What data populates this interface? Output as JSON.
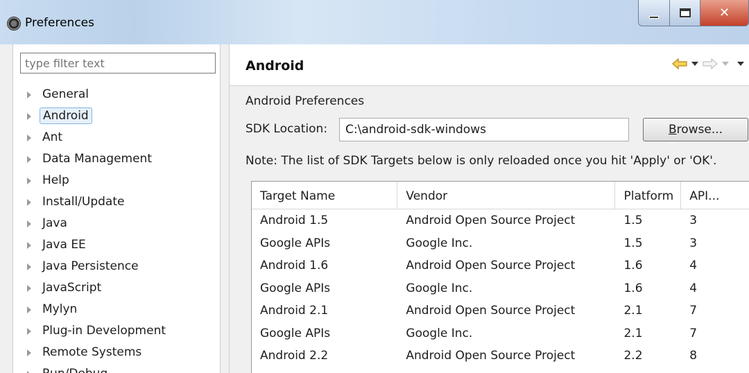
{
  "window": {
    "title": "Preferences"
  },
  "left": {
    "filter_placeholder": "type filter text",
    "tree": [
      {
        "label": "General",
        "selected": false
      },
      {
        "label": "Android",
        "selected": true
      },
      {
        "label": "Ant",
        "selected": false
      },
      {
        "label": "Data Management",
        "selected": false
      },
      {
        "label": "Help",
        "selected": false
      },
      {
        "label": "Install/Update",
        "selected": false
      },
      {
        "label": "Java",
        "selected": false
      },
      {
        "label": "Java EE",
        "selected": false
      },
      {
        "label": "Java Persistence",
        "selected": false
      },
      {
        "label": "JavaScript",
        "selected": false
      },
      {
        "label": "Mylyn",
        "selected": false
      },
      {
        "label": "Plug-in Development",
        "selected": false
      },
      {
        "label": "Remote Systems",
        "selected": false
      },
      {
        "label": "Run/Debug",
        "selected": false
      }
    ]
  },
  "main": {
    "heading": "Android",
    "prefs_label": "Android Preferences",
    "sdk_label": "SDK Location:",
    "sdk_value": "C:\\android-sdk-windows",
    "browse_label": "Browse...",
    "note": "Note: The list of SDK Targets below is only reloaded once you hit 'Apply' or 'OK'.",
    "table": {
      "headers": [
        "Target Name",
        "Vendor",
        "Platform",
        "API..."
      ],
      "rows": [
        [
          "Android 1.5",
          "Android Open Source Project",
          "1.5",
          "3"
        ],
        [
          "Google APIs",
          "Google Inc.",
          "1.5",
          "3"
        ],
        [
          "Android 1.6",
          "Android Open Source Project",
          "1.6",
          "4"
        ],
        [
          "Google APIs",
          "Google Inc.",
          "1.6",
          "4"
        ],
        [
          "Android 2.1",
          "Android Open Source Project",
          "2.1",
          "7"
        ],
        [
          "Google APIs",
          "Google Inc.",
          "2.1",
          "7"
        ],
        [
          "Android 2.2",
          "Android Open Source Project",
          "2.2",
          "8"
        ]
      ]
    }
  },
  "icons": {
    "app": "eclipse-icon",
    "back": "back-arrow-icon",
    "forward": "forward-arrow-icon",
    "menu": "view-menu-icon"
  },
  "colors": {
    "back_arrow": "#e8c23a",
    "selection": "#e6f0fa",
    "close_button": "#c4412a"
  }
}
